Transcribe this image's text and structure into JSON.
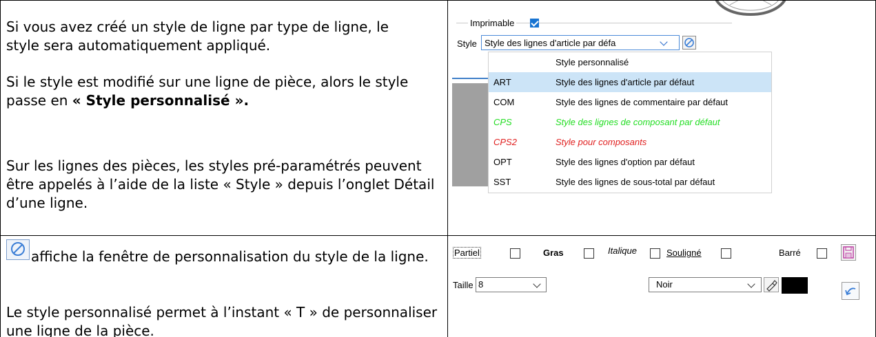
{
  "row1": {
    "left": {
      "p1": "Si vous avez créé un style de ligne par type de ligne, le style sera automatiquement appliqué.",
      "p2_prefix": "Si le style est modifié sur une ligne de pièce, alors le style passe en ",
      "p2_bold": "« Style personnalisé ».",
      "p3": "Sur les lignes des pièces, les styles pré-paramétrés peuvent être appelés à l’aide de la liste « Style » depuis l’onglet Détail d’une ligne."
    },
    "right": {
      "imprimable_label": "Imprimable",
      "imprimable_checked": true,
      "style_label": "Style",
      "style_value": "Style des lignes d'article par défa",
      "dropdown": [
        {
          "code": "",
          "desc": "Style personnalisé",
          "color": "normal"
        },
        {
          "code": "ART",
          "desc": "Style des lignes d'article par défaut",
          "color": "selected"
        },
        {
          "code": "COM",
          "desc": "Style des lignes de commentaire par défaut",
          "color": "normal"
        },
        {
          "code": "CPS",
          "desc": "Style des lignes de composant par défaut",
          "color": "green"
        },
        {
          "code": "CPS2",
          "desc": "Style pour composants",
          "color": "red"
        },
        {
          "code": "OPT",
          "desc": "Style des lignes d'option par défaut",
          "color": "normal"
        },
        {
          "code": "SST",
          "desc": "Style des lignes de sous-total par défaut",
          "color": "normal"
        }
      ],
      "colors": {
        "selected_bg": "#cce4f7",
        "green": "#22dd22",
        "red": "#e01e1e"
      }
    }
  },
  "row2": {
    "left": {
      "p1_after_icon": " affiche la fenêtre de personnalisation du style de la ligne.",
      "p2": "Le style personnalisé permet à l’instant « T » de personnaliser une ligne de la pièce."
    },
    "right": {
      "partiel": "Partiel",
      "gras": "Gras",
      "italique": "Italique",
      "souligne": "Souligné",
      "barre": "Barré",
      "taille_label": "Taille",
      "taille_value": "8",
      "couleur_value": "Noir",
      "swatch_color": "#000000"
    }
  }
}
